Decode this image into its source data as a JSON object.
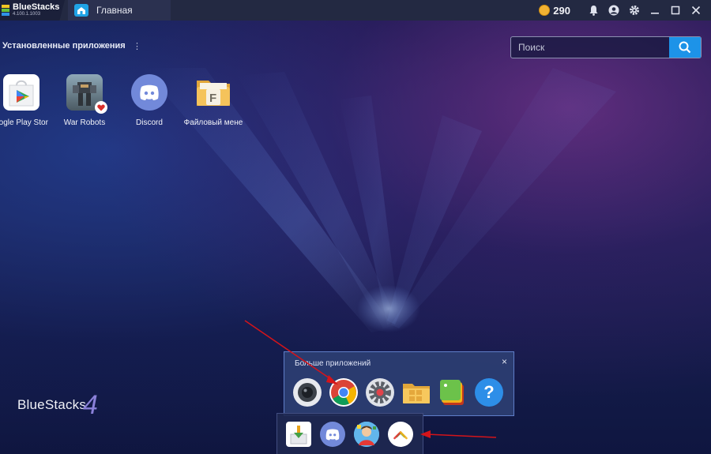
{
  "titlebar": {
    "brand_name": "BlueStacks",
    "brand_version": "4.100.1.1003",
    "tab_label": "Главная",
    "coins": "290"
  },
  "desktop": {
    "section_title": "Установленные приложения",
    "section_menu": "⋮",
    "search_placeholder": "Поиск",
    "apps": [
      {
        "label": "oogle Play Stor",
        "icon": "google-play-icon"
      },
      {
        "label": "War Robots",
        "icon": "war-robots-icon"
      },
      {
        "label": "Discord",
        "icon": "discord-icon"
      },
      {
        "label": "Файловый мене",
        "icon": "file-manager-icon"
      }
    ],
    "logo_text": "BlueStacks",
    "logo_number": "4"
  },
  "popup": {
    "title": "Больше приложений",
    "close": "×",
    "icons": [
      "camera-icon",
      "chrome-icon",
      "settings-icon",
      "folder-icon",
      "media-manager-icon",
      "help-icon"
    ],
    "help_glyph": "?"
  },
  "dock": {
    "icons": [
      "installer-icon",
      "discord-icon",
      "avatar-app-icon",
      "more-apps-icon"
    ]
  },
  "colors": {
    "accent": "#1d93e8",
    "arrow": "#d4141a",
    "coin": "#f2b233"
  }
}
